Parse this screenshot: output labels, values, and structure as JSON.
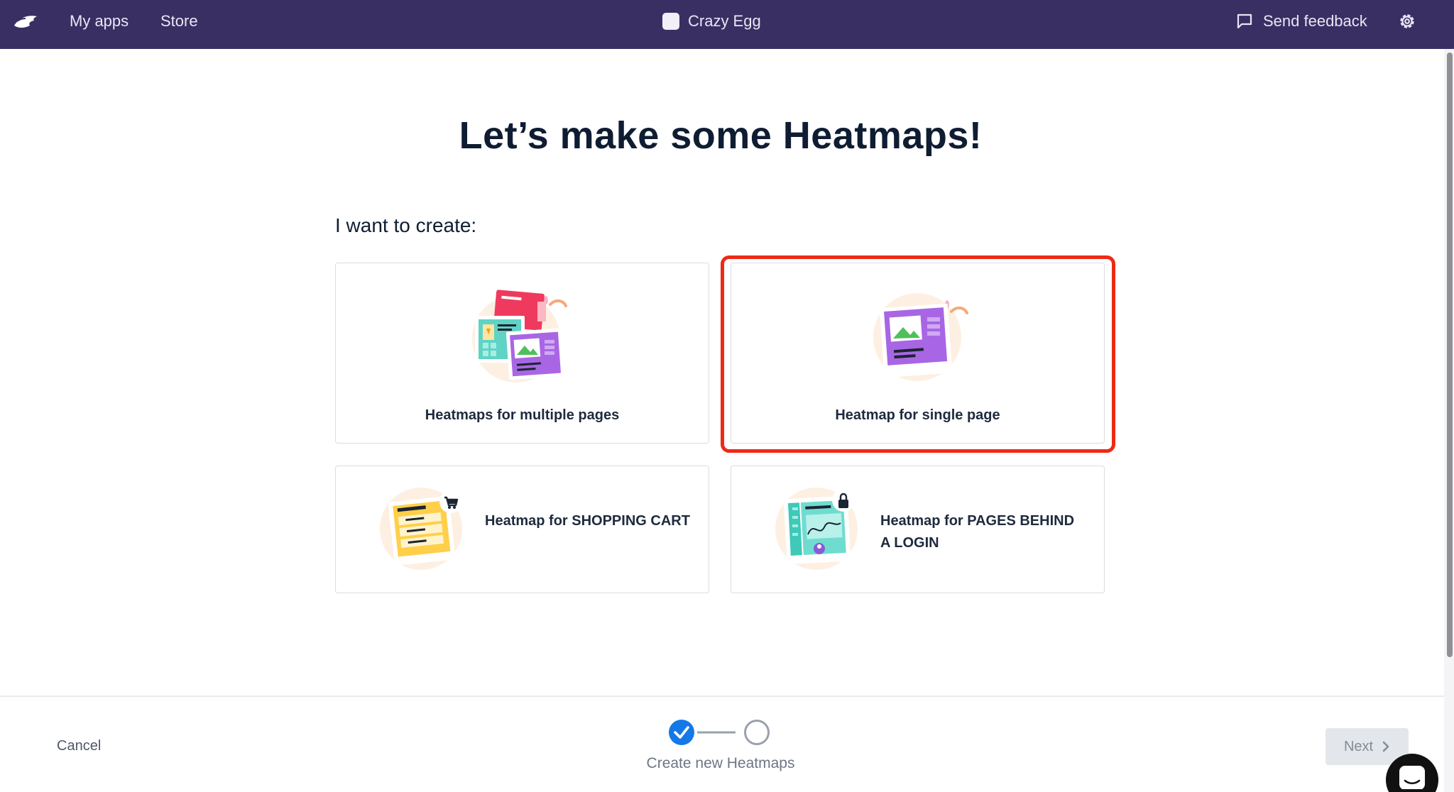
{
  "topbar": {
    "logo_icon": "crazy-egg-logo-icon",
    "nav": [
      {
        "label": "My apps"
      },
      {
        "label": "Store"
      }
    ],
    "app_name": "Crazy Egg",
    "feedback_label": "Send feedback",
    "feedback_icon": "message-square-icon",
    "settings_icon": "gear-icon",
    "background_color": "#3a2f63"
  },
  "main": {
    "title": "Let’s make some Heatmaps!",
    "subheading": "I want to create:",
    "options": [
      {
        "label": "Heatmaps for multiple pages",
        "icon": "multiple-pages-illustration-icon"
      },
      {
        "label": "Heatmap for single page",
        "icon": "single-page-illustration-icon",
        "highlighted": true
      },
      {
        "label": "Heatmap for SHOPPING CART",
        "icon": "shopping-cart-illustration-icon"
      },
      {
        "label": "Heatmap for PAGES BEHIND A LOGIN",
        "icon": "login-page-illustration-icon"
      }
    ],
    "highlight_color": "#ee2a16"
  },
  "footer": {
    "cancel_label": "Cancel",
    "step_caption": "Create new Heatmaps",
    "steps": [
      {
        "state": "complete"
      },
      {
        "state": "pending"
      }
    ],
    "next_label": "Next",
    "accent_color": "#1479e6"
  }
}
